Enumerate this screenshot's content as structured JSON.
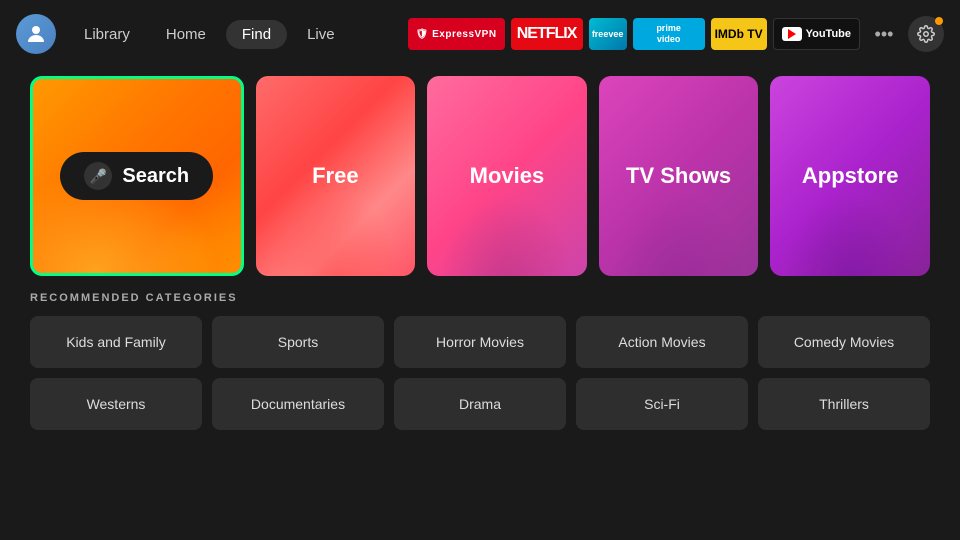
{
  "nav": {
    "items": [
      {
        "label": "Library",
        "active": false
      },
      {
        "label": "Home",
        "active": false
      },
      {
        "label": "Find",
        "active": true
      },
      {
        "label": "Live",
        "active": false
      }
    ]
  },
  "apps": [
    {
      "name": "expressvpn",
      "label": "ExpressVPN"
    },
    {
      "name": "netflix",
      "label": "NETFLIX"
    },
    {
      "name": "freevee",
      "label": "freevee"
    },
    {
      "name": "prime",
      "label": "prime video"
    },
    {
      "name": "imdb",
      "label": "IMDb TV"
    },
    {
      "name": "youtube",
      "label": "YouTube"
    }
  ],
  "tiles": [
    {
      "id": "search",
      "label": "Search"
    },
    {
      "id": "free",
      "label": "Free"
    },
    {
      "id": "movies",
      "label": "Movies"
    },
    {
      "id": "tvshows",
      "label": "TV Shows"
    },
    {
      "id": "appstore",
      "label": "Appstore"
    }
  ],
  "categories_title": "RECOMMENDED CATEGORIES",
  "categories": [
    {
      "label": "Kids and Family"
    },
    {
      "label": "Sports"
    },
    {
      "label": "Horror Movies"
    },
    {
      "label": "Action Movies"
    },
    {
      "label": "Comedy Movies"
    },
    {
      "label": "Westerns"
    },
    {
      "label": "Documentaries"
    },
    {
      "label": "Drama"
    },
    {
      "label": "Sci-Fi"
    },
    {
      "label": "Thrillers"
    }
  ]
}
